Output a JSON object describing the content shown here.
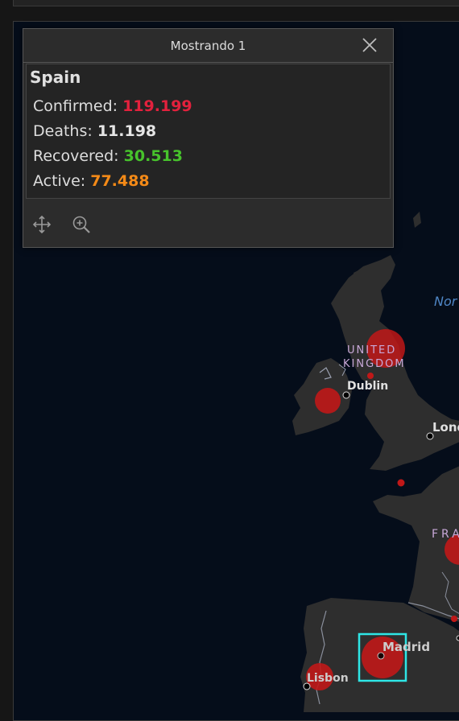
{
  "popup": {
    "title": "Mostrando 1",
    "country": "Spain",
    "stats": [
      {
        "label": "Confirmed:",
        "value": "119.199",
        "color": "#e3213d"
      },
      {
        "label": "Deaths:",
        "value": "11.198",
        "color": "#e6e6e6"
      },
      {
        "label": "Recovered:",
        "value": "30.513",
        "color": "#47c32c"
      },
      {
        "label": "Active:",
        "value": "77.488",
        "color": "#f48a17"
      }
    ],
    "icons": [
      "pan-icon",
      "zoom-to-icon",
      "close-icon"
    ]
  },
  "map": {
    "labels": {
      "north_sea": "Nor",
      "uk_line1": "UNITED",
      "uk_line2": "KINGDOM",
      "dublin": "Dublin",
      "london": "Lond",
      "france": "FRA",
      "madrid": "Madrid",
      "lisbon": "Lisbon"
    },
    "colors": {
      "water": "#050d1a",
      "land": "#2e2e2e",
      "bubble": "#c01818",
      "selection": "#2ee6e6"
    }
  }
}
